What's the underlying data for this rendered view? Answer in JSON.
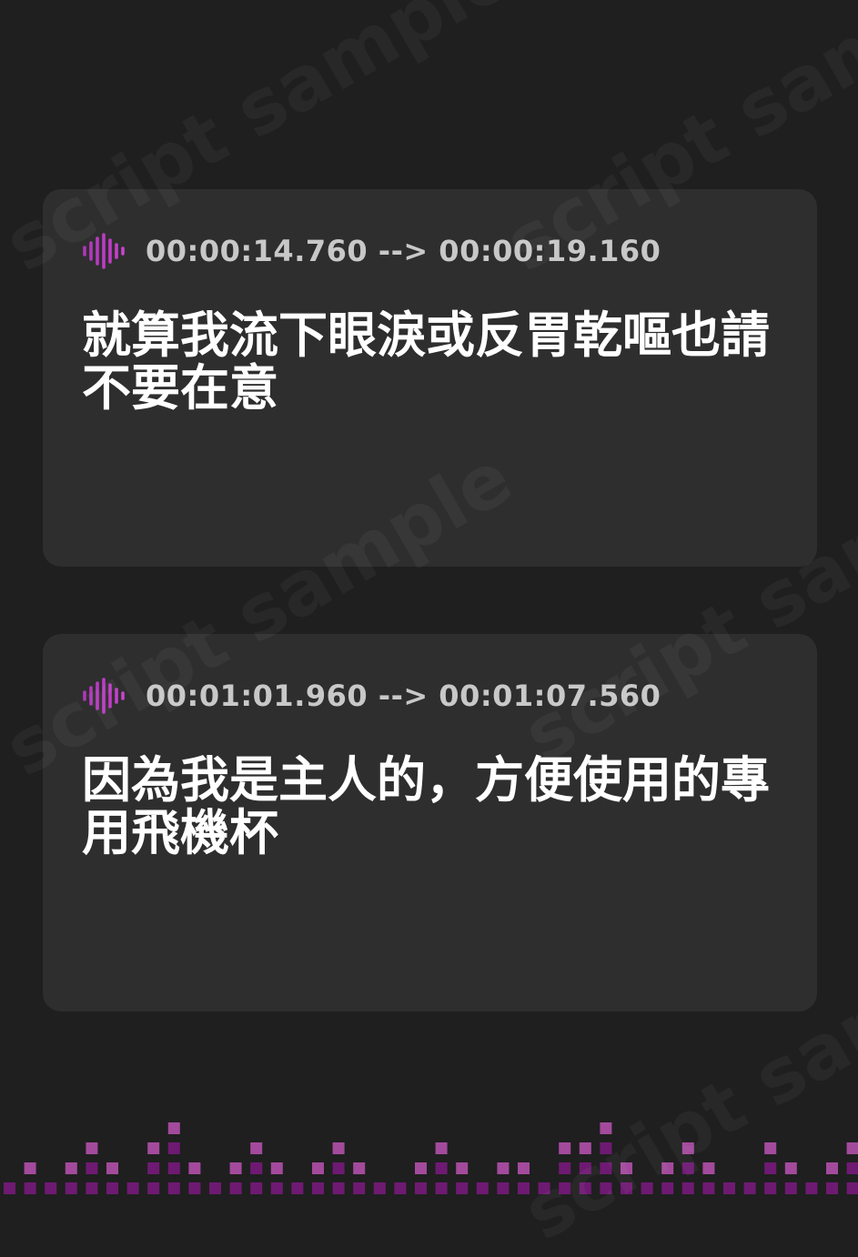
{
  "watermark": "script sample",
  "colors": {
    "background": "#1f1f1f",
    "card": "#2e2e2e",
    "timestamp": "#c8c8c8",
    "subtitle": "#ffffff",
    "accent": "#c03bc6",
    "equalizer_light": "#a34a9c",
    "equalizer_dark": "#6e1a72"
  },
  "entries": [
    {
      "icon": "waveform-icon",
      "timestamp": "00:00:14.760 --> 00:00:19.160",
      "text": "就算我流下眼淚或反胃乾嘔也請不要在意"
    },
    {
      "icon": "waveform-icon",
      "timestamp": "00:01:01.960 --> 00:01:07.560",
      "text": "因為我是主人的，方便使用的專用飛機杯"
    }
  ]
}
